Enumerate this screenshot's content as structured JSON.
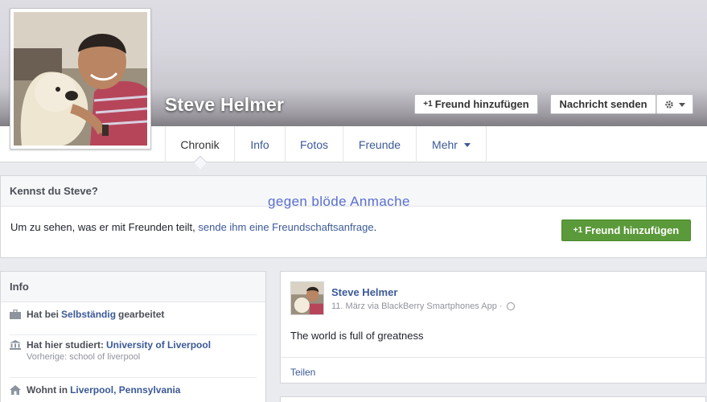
{
  "profile": {
    "name": "Steve Helmer"
  },
  "actions": {
    "add_friend_icon": "+1",
    "add_friend": "Freund hinzufügen",
    "send_message": "Nachricht senden",
    "settings_icon": "gear-icon"
  },
  "tabs": [
    {
      "label": "Chronik"
    },
    {
      "label": "Info"
    },
    {
      "label": "Fotos"
    },
    {
      "label": "Freunde"
    },
    {
      "label": "Mehr"
    }
  ],
  "know": {
    "title": "Kennst du Steve?",
    "text_before": "Um zu sehen, was er mit Freunden teilt, ",
    "link": "sende ihm eine Freundschaftsanfrage",
    "text_after": ".",
    "button": "Freund hinzufügen"
  },
  "overlay": "gegen blöde Anmache",
  "info": {
    "title": "Info",
    "work_prefix": "Hat bei",
    "work_employer": "Selbständig",
    "work_suffix": "gearbeitet",
    "study_prefix": "Hat hier studiert:",
    "study_school": "University of Liverpool",
    "study_previous": "Vorherige: school of liverpool",
    "lives_prefix": "Wohnt in",
    "lives_place": "Liverpool, Pennsylvania"
  },
  "post": {
    "author": "Steve Helmer",
    "meta": "11. März via BlackBerry Smartphones App ·",
    "text": "The world is full of greatness",
    "share": "Teilen"
  },
  "colors": {
    "link": "#3b5998",
    "green_button": "#5b9a3a",
    "overlay_text": "#5a6fd0"
  }
}
